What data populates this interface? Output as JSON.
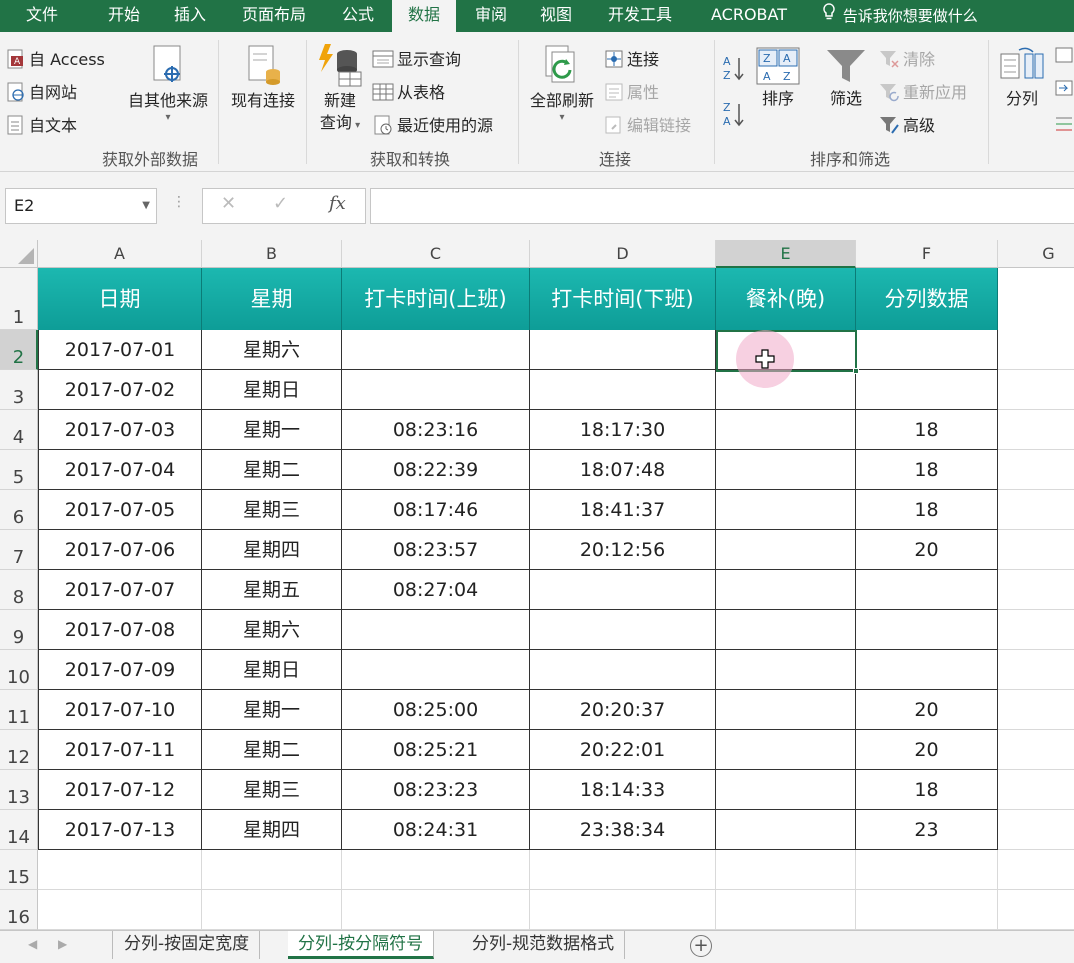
{
  "tabs": [
    {
      "label": "文件",
      "x": 0
    },
    {
      "label": "开始"
    },
    {
      "label": "插入"
    },
    {
      "label": "页面布局"
    },
    {
      "label": "公式"
    },
    {
      "label": "数据",
      "active": true
    },
    {
      "label": "审阅"
    },
    {
      "label": "视图"
    },
    {
      "label": "开发工具"
    },
    {
      "label": "ACROBAT"
    }
  ],
  "tell_me": "告诉我你想要做什么",
  "ribbon": {
    "get_external": {
      "from_access": "自 Access",
      "from_web": "自网站",
      "from_text": "自文本",
      "from_other": "自其他来源",
      "existing": "现有连接",
      "label": "获取外部数据"
    },
    "get_transform": {
      "new_query_1": "新建",
      "new_query_2": "查询",
      "show_queries": "显示查询",
      "from_table": "从表格",
      "recent_sources": "最近使用的源",
      "label": "获取和转换"
    },
    "connections": {
      "refresh_all": "全部刷新",
      "connections": "连接",
      "properties": "属性",
      "edit_links": "编辑链接",
      "label": "连接"
    },
    "sort_filter": {
      "sort": "排序",
      "filter": "筛选",
      "clear": "清除",
      "reapply": "重新应用",
      "advanced": "高级",
      "label": "排序和筛选"
    },
    "data_tools": {
      "text_to_columns": "分列"
    }
  },
  "formula_bar": {
    "name_box": "E2",
    "formula": ""
  },
  "columns": [
    "A",
    "B",
    "C",
    "D",
    "E",
    "F",
    "G"
  ],
  "selected_column": "E",
  "selected_row": 2,
  "header_row": [
    "日期",
    "星期",
    "打卡时间(上班)",
    "打卡时间(下班)",
    "餐补(晚)",
    "分列数据"
  ],
  "rows": [
    [
      "2017-07-01",
      "星期六",
      "",
      "",
      "",
      ""
    ],
    [
      "2017-07-02",
      "星期日",
      "",
      "",
      "",
      ""
    ],
    [
      "2017-07-03",
      "星期一",
      "08:23:16",
      "18:17:30",
      "",
      "18"
    ],
    [
      "2017-07-04",
      "星期二",
      "08:22:39",
      "18:07:48",
      "",
      "18"
    ],
    [
      "2017-07-05",
      "星期三",
      "08:17:46",
      "18:41:37",
      "",
      "18"
    ],
    [
      "2017-07-06",
      "星期四",
      "08:23:57",
      "20:12:56",
      "",
      "20"
    ],
    [
      "2017-07-07",
      "星期五",
      "08:27:04",
      "",
      "",
      ""
    ],
    [
      "2017-07-08",
      "星期六",
      "",
      "",
      "",
      ""
    ],
    [
      "2017-07-09",
      "星期日",
      "",
      "",
      "",
      ""
    ],
    [
      "2017-07-10",
      "星期一",
      "08:25:00",
      "20:20:37",
      "",
      "20"
    ],
    [
      "2017-07-11",
      "星期二",
      "08:25:21",
      "20:22:01",
      "",
      "20"
    ],
    [
      "2017-07-12",
      "星期三",
      "08:23:23",
      "18:14:33",
      "",
      "18"
    ],
    [
      "2017-07-13",
      "星期四",
      "08:24:31",
      "23:38:34",
      "",
      "23"
    ]
  ],
  "row_numbers": [
    "1",
    "2",
    "3",
    "4",
    "5",
    "6",
    "7",
    "8",
    "9",
    "10",
    "11",
    "12",
    "13",
    "14",
    "15",
    "16"
  ],
  "sheets": [
    {
      "label": "分列-按固定宽度"
    },
    {
      "label": "分列-按分隔符号",
      "active": true
    },
    {
      "label": "分列-规范数据格式"
    }
  ],
  "colors": {
    "excel_green": "#217346",
    "header_teal": "#13aaa4"
  }
}
